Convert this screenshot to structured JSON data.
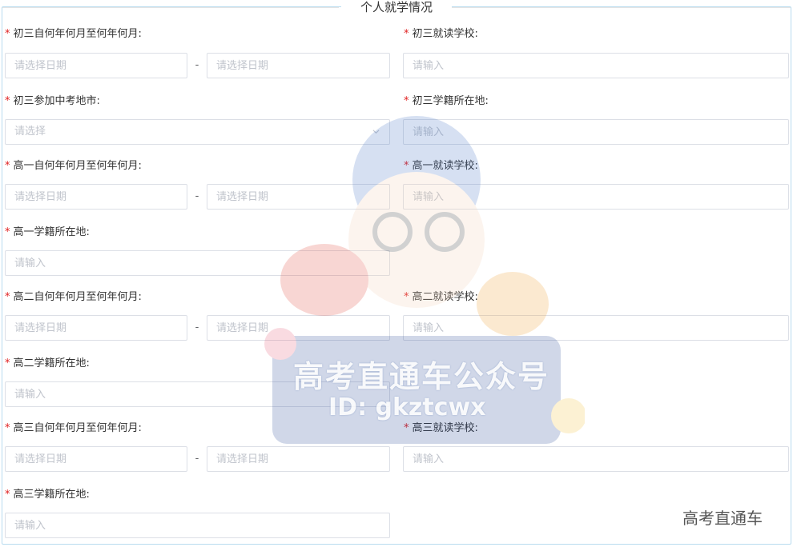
{
  "section": {
    "title": "个人就学情况"
  },
  "rows": {
    "r1": {
      "left_label": "初三自何年何月至何年何月:",
      "start_placeholder": "请选择日期",
      "separator": "-",
      "end_placeholder": "请选择日期",
      "right_label": "初三就读学校:",
      "right_placeholder": "请输入"
    },
    "r2": {
      "left_label": "初三参加中考地市:",
      "select_placeholder": "请选择",
      "right_label": "初三学籍所在地:",
      "right_placeholder": "请输入"
    },
    "r3": {
      "left_label": "高一自何年何月至何年何月:",
      "start_placeholder": "请选择日期",
      "separator": "-",
      "end_placeholder": "请选择日期",
      "right_label": "高一就读学校:",
      "right_placeholder": "请输入"
    },
    "r4": {
      "left_label": "高一学籍所在地:",
      "left_placeholder": "请输入"
    },
    "r5": {
      "left_label": "高二自何年何月至何年何月:",
      "start_placeholder": "请选择日期",
      "separator": "-",
      "end_placeholder": "请选择日期",
      "right_label": "高二就读学校:",
      "right_placeholder": "请输入"
    },
    "r6": {
      "left_label": "高二学籍所在地:",
      "left_placeholder": "请输入"
    },
    "r7": {
      "left_label": "高三自何年何月至何年何月:",
      "start_placeholder": "请选择日期",
      "separator": "-",
      "end_placeholder": "请选择日期",
      "right_label": "高三就读学校:",
      "right_placeholder": "请输入"
    },
    "r8": {
      "left_label": "高三学籍所在地:",
      "left_placeholder": "请输入"
    }
  },
  "required_mark": "*",
  "watermark": {
    "line1": "高考直通车公众号",
    "line2": "ID: gkztcwx",
    "corner": "高考直通车"
  },
  "colors": {
    "required": "#e02020",
    "border": "#dcdfe6",
    "placeholder": "#c0c4cc",
    "frame": "#b8dcef"
  },
  "icons": {
    "select_arrow": "chevron-down-icon"
  }
}
